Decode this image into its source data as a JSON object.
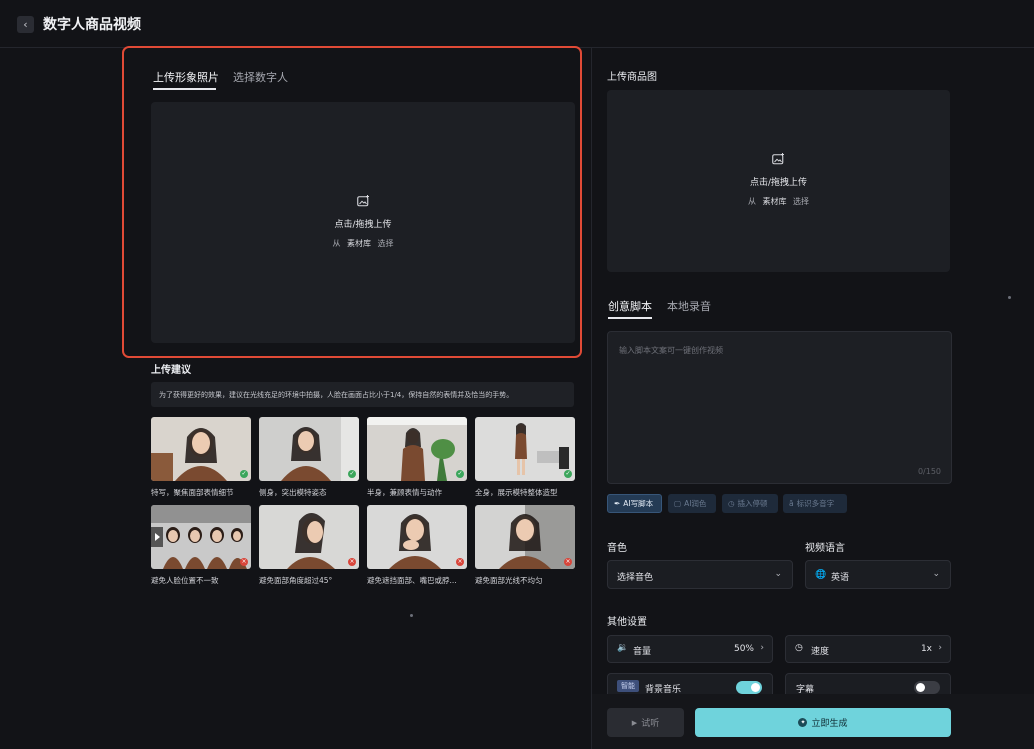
{
  "header": {
    "title": "数字人商品视频"
  },
  "upload": {
    "tabs": [
      "上传形象照片",
      "选择数字人"
    ],
    "dropzone": {
      "main": "点击/拖拽上传",
      "from": "从",
      "library": "素材库",
      "choose": "选择"
    }
  },
  "advice": {
    "title": "上传建议",
    "tip": "为了获得更好的效果，建议在光线充足的环境中拍摄，人脸在画面占比小于1/4，保持自然的表情并及恰当的手势。",
    "good": [
      "特写，聚焦面部表情细节",
      "侧身，突出模特姿态",
      "半身，兼顾表情与动作",
      "全身，展示模特整体造型"
    ],
    "bad": [
      "避免人脸位置不一致",
      "避免面部角度超过45°",
      "避免遮挡面部、嘴巴或脖...",
      "避免面部光线不均匀"
    ]
  },
  "product": {
    "title": "上传商品图",
    "dropzone": {
      "main": "点击/拖拽上传",
      "from": "从",
      "library": "素材库",
      "choose": "选择"
    }
  },
  "script": {
    "tabs": [
      "创意脚本",
      "本地录音"
    ],
    "placeholder": "输入脚本文案可一键创作视频",
    "counter": "0/150",
    "chips": [
      "AI写脚本",
      "AI润色",
      "插入停顿",
      "标识多音字"
    ]
  },
  "voice": {
    "label": "音色",
    "value": "选择音色"
  },
  "language": {
    "label": "视频语言",
    "value": "英语"
  },
  "other": {
    "title": "其他设置",
    "volume_label": "音量",
    "volume_value": "50%",
    "speed_label": "速度",
    "speed_value": "1x",
    "smart_tag": "智能",
    "bgm_label": "背景音乐",
    "bgm_on": true,
    "subtitle_label": "字幕",
    "subtitle_on": false
  },
  "actions": {
    "preview": "试听",
    "generate": "立即生成"
  },
  "colors": {
    "accent": "#6fd3dc",
    "highlight_border": "#e04a36",
    "ok": "#3ca65c",
    "error": "#d8453a"
  }
}
